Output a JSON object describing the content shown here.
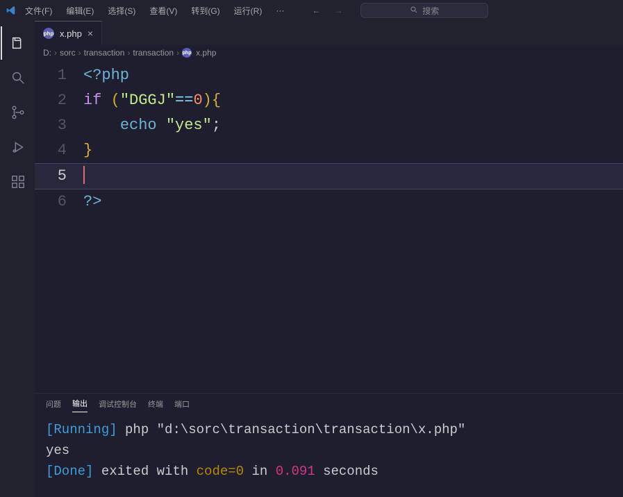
{
  "menu": {
    "file": "文件(F)",
    "edit": "编辑(E)",
    "select": "选择(S)",
    "view": "查看(V)",
    "goto": "转到(G)",
    "run": "运行(R)",
    "more": "···"
  },
  "search": {
    "placeholder": "搜索"
  },
  "tab": {
    "filename": "x.php",
    "icon_text": "php"
  },
  "breadcrumbs": {
    "items": [
      "D:",
      "sorc",
      "transaction",
      "transaction"
    ],
    "file": "x.php"
  },
  "code": {
    "line_numbers": [
      "1",
      "2",
      "3",
      "4",
      "5",
      "6"
    ],
    "tokens": {
      "open": "<?php",
      "if": "if",
      "lparen": "(",
      "str_dggj": "\"DGGJ\"",
      "eqeq": "==",
      "zero": "0",
      "rparen": ")",
      "lbrace": "{",
      "echo": "echo",
      "str_yes": "\"yes\"",
      "semi": ";",
      "rbrace": "}",
      "close": "?>"
    }
  },
  "panel": {
    "tabs": {
      "problems": "问题",
      "output": "输出",
      "debug": "调试控制台",
      "terminal": "终端",
      "ports": "端口"
    },
    "output": {
      "running_bracket": "[Running]",
      "running_rest": " php \"d:\\sorc\\transaction\\transaction\\x.php\"",
      "yes": "yes",
      "done_bracket": "[Done]",
      "done_exit": " exited with ",
      "done_code": "code=0",
      "done_in": " in ",
      "done_time": "0.091",
      "done_sec": " seconds"
    }
  }
}
